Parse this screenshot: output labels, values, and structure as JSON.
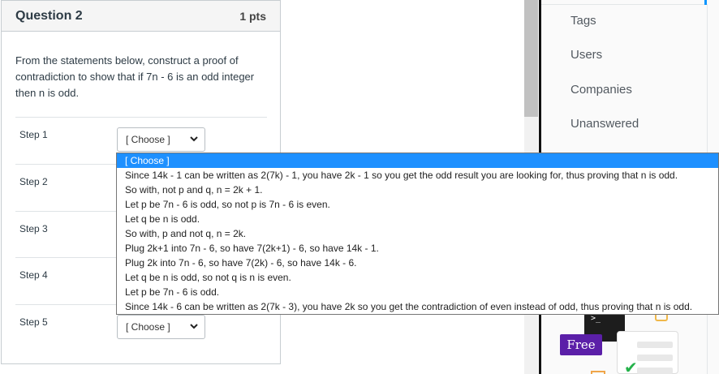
{
  "question": {
    "title": "Question 2",
    "points": "1 pts",
    "text": "From the statements below, construct a proof of contradiction to show that if 7n - 6 is an odd integer then n is odd.",
    "steps": [
      {
        "label": "Step 1",
        "value": "[ Choose ]"
      },
      {
        "label": "Step 2",
        "value": "[ Choose ]"
      },
      {
        "label": "Step 3",
        "value": "[ Choose ]"
      },
      {
        "label": "Step 4",
        "value": "[ Choose ]"
      },
      {
        "label": "Step 5",
        "value": "[ Choose ]"
      }
    ]
  },
  "dropdown": {
    "options": [
      "[ Choose ]",
      "Since 14k - 1 can be written as 2(7k) - 1, you have 2k - 1 so you get the odd result you are looking for, thus proving that n is odd.",
      "So with, not p and q, n = 2k + 1.",
      "Let p be 7n - 6 is odd, so not p is 7n - 6 is even.",
      "Let q be n is odd.",
      "So with, p and not q, n = 2k.",
      "Plug 2k+1 into 7n - 6, so have 7(2k+1) - 6, so have 14k - 1.",
      "Plug 2k into 7n - 6, so have 7(2k) - 6, so have 14k - 6.",
      "Let q be n is odd, so not q is n is even.",
      "Let p be 7n - 6 is odd.",
      "Since 14k - 6 can be written as 2(7k - 3), you have 2k so you get the contradiction of even instead of odd, thus proving that n is odd."
    ],
    "selected_index": 0
  },
  "sidebar": {
    "items": [
      "Tags",
      "Users",
      "Companies",
      "Unanswered"
    ]
  },
  "ad": {
    "badge": "Free",
    "prompt": ">_"
  },
  "colors": {
    "selected_option": "#1e90ff",
    "accent": "#0a95ff",
    "free_badge": "#5b1fa8"
  }
}
